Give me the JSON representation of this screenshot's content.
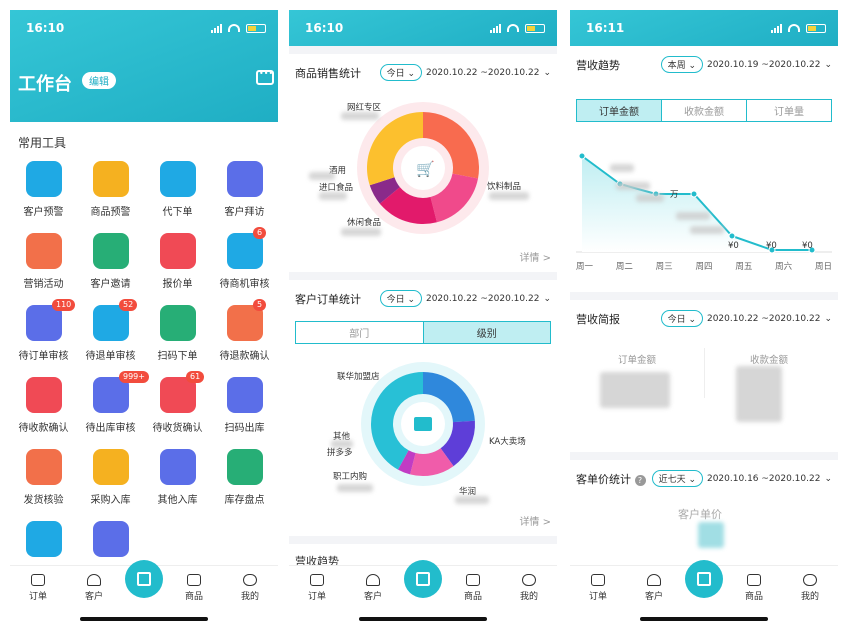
{
  "phone1": {
    "time": "16:10",
    "title": "工作台",
    "edit": "编辑",
    "section": "常用工具",
    "tools": [
      {
        "label": "客户预警",
        "color": "#1fa9e4",
        "badge": ""
      },
      {
        "label": "商品预警",
        "color": "#f5b120",
        "badge": ""
      },
      {
        "label": "代下单",
        "color": "#1fa9e4",
        "badge": ""
      },
      {
        "label": "客户拜访",
        "color": "#5b6ee8",
        "badge": ""
      },
      {
        "label": "营销活动",
        "color": "#f2704a",
        "badge": ""
      },
      {
        "label": "客户邀请",
        "color": "#27ae76",
        "badge": ""
      },
      {
        "label": "报价单",
        "color": "#f04a55",
        "badge": ""
      },
      {
        "label": "待商机审核",
        "color": "#1fa9e4",
        "badge": "6"
      },
      {
        "label": "待订单审核",
        "color": "#5b6ee8",
        "badge": "110"
      },
      {
        "label": "待退单审核",
        "color": "#1fa9e4",
        "badge": "52"
      },
      {
        "label": "扫码下单",
        "color": "#27ae76",
        "badge": ""
      },
      {
        "label": "待退款确认",
        "color": "#f2704a",
        "badge": "5"
      },
      {
        "label": "待收款确认",
        "color": "#f04a55",
        "badge": ""
      },
      {
        "label": "待出库审核",
        "color": "#5b6ee8",
        "badge": "999+"
      },
      {
        "label": "待收货确认",
        "color": "#f04a55",
        "badge": "61"
      },
      {
        "label": "扫码出库",
        "color": "#5b6ee8",
        "badge": ""
      },
      {
        "label": "发货核验",
        "color": "#f2704a",
        "badge": ""
      },
      {
        "label": "采购入库",
        "color": "#f5b120",
        "badge": ""
      },
      {
        "label": "其他入库",
        "color": "#5b6ee8",
        "badge": ""
      },
      {
        "label": "库存盘点",
        "color": "#27ae76",
        "badge": ""
      },
      {
        "label": "",
        "color": "#1fa9e4",
        "badge": ""
      },
      {
        "label": "",
        "color": "#5b6ee8",
        "badge": ""
      }
    ]
  },
  "tabs": {
    "orders": "订单",
    "customers": "客户",
    "goods": "商品",
    "mine": "我的"
  },
  "phone2": {
    "time": "16:10",
    "sales_title": "商品销售统计",
    "today": "今日",
    "range": "2020.10.22 ~2020.10.22",
    "sales_labels": {
      "a": "网红专区",
      "b": "酒用",
      "c": "进口食品",
      "d": "休闲食品",
      "e": "饮料制品"
    },
    "detail": "详情 >",
    "cust_title": "客户订单统计",
    "seg_dept": "部门",
    "seg_level": "级别",
    "cust_labels": {
      "a": "联华加盟店",
      "b": "其他",
      "c": "拼多多",
      "d": "职工内购",
      "e": "华润",
      "f": "KA大卖场"
    },
    "next_title": "营收趋势"
  },
  "phone3": {
    "time": "16:11",
    "trend_title": "营收趋势",
    "week": "本周",
    "trend_range": "2020.10.19 ~2020.10.22",
    "seg": [
      "订单金额",
      "收款金额",
      "订单量"
    ],
    "days": [
      "周一",
      "周二",
      "周三",
      "周四",
      "周五",
      "周六",
      "周日"
    ],
    "zeros": [
      "¥0",
      "¥0",
      "¥0"
    ],
    "wan": "万",
    "brief_title": "营收简报",
    "today": "今日",
    "brief_range": "2020.10.22 ~2020.10.22",
    "order_amount": "订单金额",
    "collect_amount": "收款金额",
    "price_title": "客单价统计",
    "seven": "近七天",
    "price_range": "2020.10.16 ~2020.10.22",
    "price_label": "客户单价"
  }
}
